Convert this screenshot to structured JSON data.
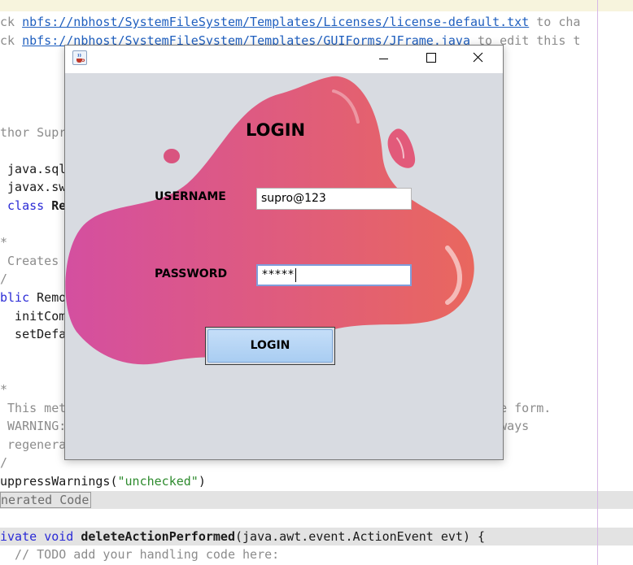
{
  "editor": {
    "lines": [
      [
        {
          "text": "ck ",
          "cls": "comment"
        },
        {
          "text": "nbfs://nbhost/SystemFileSystem/Templates/Licenses/license-default.txt",
          "cls": "link"
        },
        {
          "text": " to cha",
          "cls": "comment"
        }
      ],
      [
        {
          "text": "ck ",
          "cls": "comment"
        },
        {
          "text": "nbfs://nbhost/SystemFileSystem/Templates/GUIForms/JFrame.java",
          "cls": "link"
        },
        {
          "text": " to edit this t",
          "cls": "comment"
        }
      ],
      [],
      [],
      [],
      [],
      [
        {
          "text": "thor Supr",
          "cls": "comment"
        }
      ],
      [],
      [
        {
          "text": " java.sql",
          "cls": ""
        }
      ],
      [
        {
          "text": " javax.sw",
          "cls": ""
        }
      ],
      [
        {
          "text": " class ",
          "cls": "kw"
        },
        {
          "text": "Re",
          "cls": "bold"
        }
      ],
      [],
      [
        {
          "text": "*",
          "cls": "comment"
        }
      ],
      [
        {
          "text": " Creates",
          "cls": "comment"
        }
      ],
      [
        {
          "text": "/",
          "cls": "comment"
        }
      ],
      [
        {
          "text": "blic ",
          "cls": "kw"
        },
        {
          "text": "Remo",
          "cls": ""
        }
      ],
      [
        {
          "text": "  initCom",
          "cls": ""
        }
      ],
      [
        {
          "text": "  setDefa",
          "cls": ""
        }
      ],
      [],
      [],
      [
        {
          "text": "*",
          "cls": "comment"
        }
      ],
      [
        {
          "text": " This met                                                      ze the form.",
          "cls": "comment"
        }
      ],
      [
        {
          "text": " WARNING:                                                      is always",
          "cls": "comment"
        }
      ],
      [
        {
          "text": " regenera",
          "cls": "comment"
        }
      ],
      [
        {
          "text": "/",
          "cls": "comment"
        }
      ],
      [
        {
          "text": "uppressWarnings(",
          "cls": ""
        },
        {
          "text": "\"unchecked\"",
          "cls": "str"
        },
        {
          "text": ")",
          "cls": ""
        }
      ],
      [
        {
          "text": "nerated Code",
          "cls": "fold"
        }
      ],
      [],
      [
        {
          "text": "ivate ",
          "cls": "kw"
        },
        {
          "text": "void ",
          "cls": "kw"
        },
        {
          "text": "deleteActionPerformed",
          "cls": "bold"
        },
        {
          "text": "(java.awt.event.ActionEvent evt) {",
          "cls": ""
        }
      ],
      [
        {
          "text": "  // TODO add your handling code here:",
          "cls": "comment"
        }
      ]
    ],
    "highlighted_lines": [
      26,
      28
    ]
  },
  "window": {
    "title": "",
    "controls": {
      "minimize": "minimize",
      "maximize": "maximize",
      "close": "close"
    }
  },
  "form": {
    "heading": "LOGIN",
    "username_label": "USERNAME",
    "username_value": "supro@123",
    "password_label": "PASSWORD",
    "password_value": "*****",
    "login_button": "LOGIN"
  },
  "colors": {
    "blob_left": "#d44fa0",
    "blob_right": "#e9675e",
    "panel_bg": "#d8dbe1",
    "button_fill": "#b5d4f4"
  },
  "icons": {
    "app": "java-cup-icon",
    "minimize": "minimize-icon",
    "maximize": "maximize-icon",
    "close": "close-icon"
  }
}
